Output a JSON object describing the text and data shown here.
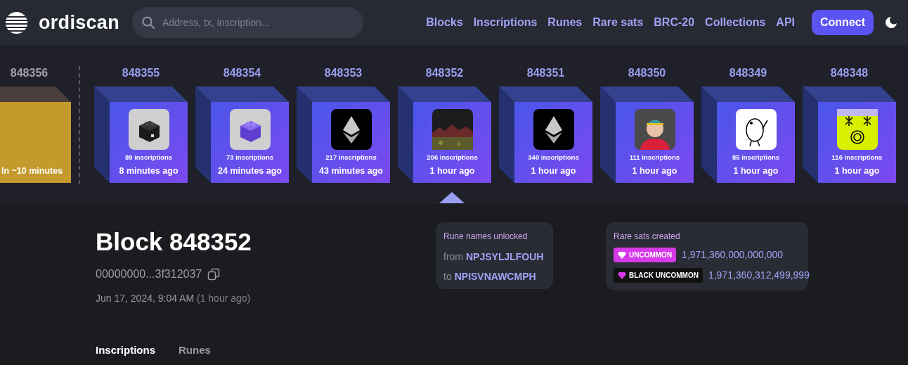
{
  "nav": {
    "logo": "ordiscan",
    "search": {
      "placeholder": "Address, tx, inscription..."
    },
    "links": [
      "Blocks",
      "Inscriptions",
      "Runes",
      "Rare sats",
      "BRC-20",
      "Collections",
      "API"
    ],
    "connect": "Connect"
  },
  "blocks": [
    {
      "kind": "pending",
      "number": "848356",
      "time": "In ~10 minutes",
      "selected": false
    },
    {
      "kind": "mined",
      "number": "848355",
      "inscriptions": "89 inscriptions",
      "time": "8 minutes ago",
      "selected": false
    },
    {
      "kind": "mined",
      "number": "848354",
      "inscriptions": "73 inscriptions",
      "time": "24 minutes ago",
      "selected": false
    },
    {
      "kind": "mined",
      "number": "848353",
      "inscriptions": "217 inscriptions",
      "time": "43 minutes ago",
      "selected": false
    },
    {
      "kind": "mined",
      "number": "848352",
      "inscriptions": "206 inscriptions",
      "time": "1 hour ago",
      "selected": true
    },
    {
      "kind": "mined",
      "number": "848351",
      "inscriptions": "340 inscriptions",
      "time": "1 hour ago",
      "selected": false
    },
    {
      "kind": "mined",
      "number": "848350",
      "inscriptions": "111 inscriptions",
      "time": "1 hour ago",
      "selected": false
    },
    {
      "kind": "mined",
      "number": "848349",
      "inscriptions": "85 inscriptions",
      "time": "1 hour ago",
      "selected": false
    },
    {
      "kind": "mined",
      "number": "848348",
      "inscriptions": "116 inscriptions",
      "time": "1 hour ago",
      "selected": false
    }
  ],
  "block": {
    "title": "Block 848352",
    "hash": "00000000...3f312037",
    "date": "Jun 17, 2024, 9:04 AM",
    "relative": "(1 hour ago)"
  },
  "rune_card": {
    "title": "Rune names unlocked",
    "rows": [
      {
        "label": "from",
        "value": "NPJSYLJLFOUH"
      },
      {
        "label": "to",
        "value": "NPISVNAWCMPH"
      }
    ]
  },
  "rare_card": {
    "title": "Rare sats created",
    "rows": [
      {
        "badge": "UNCOMMON",
        "color": "#d63ae8",
        "value": "1,971,360,000,000,000"
      },
      {
        "badge": "BLACK UNCOMMON",
        "color": "#111111",
        "value": "1,971,360,312,499,999"
      }
    ]
  },
  "tabs": [
    {
      "label": "Inscriptions",
      "selected": true
    },
    {
      "label": "Runes",
      "selected": false
    }
  ]
}
